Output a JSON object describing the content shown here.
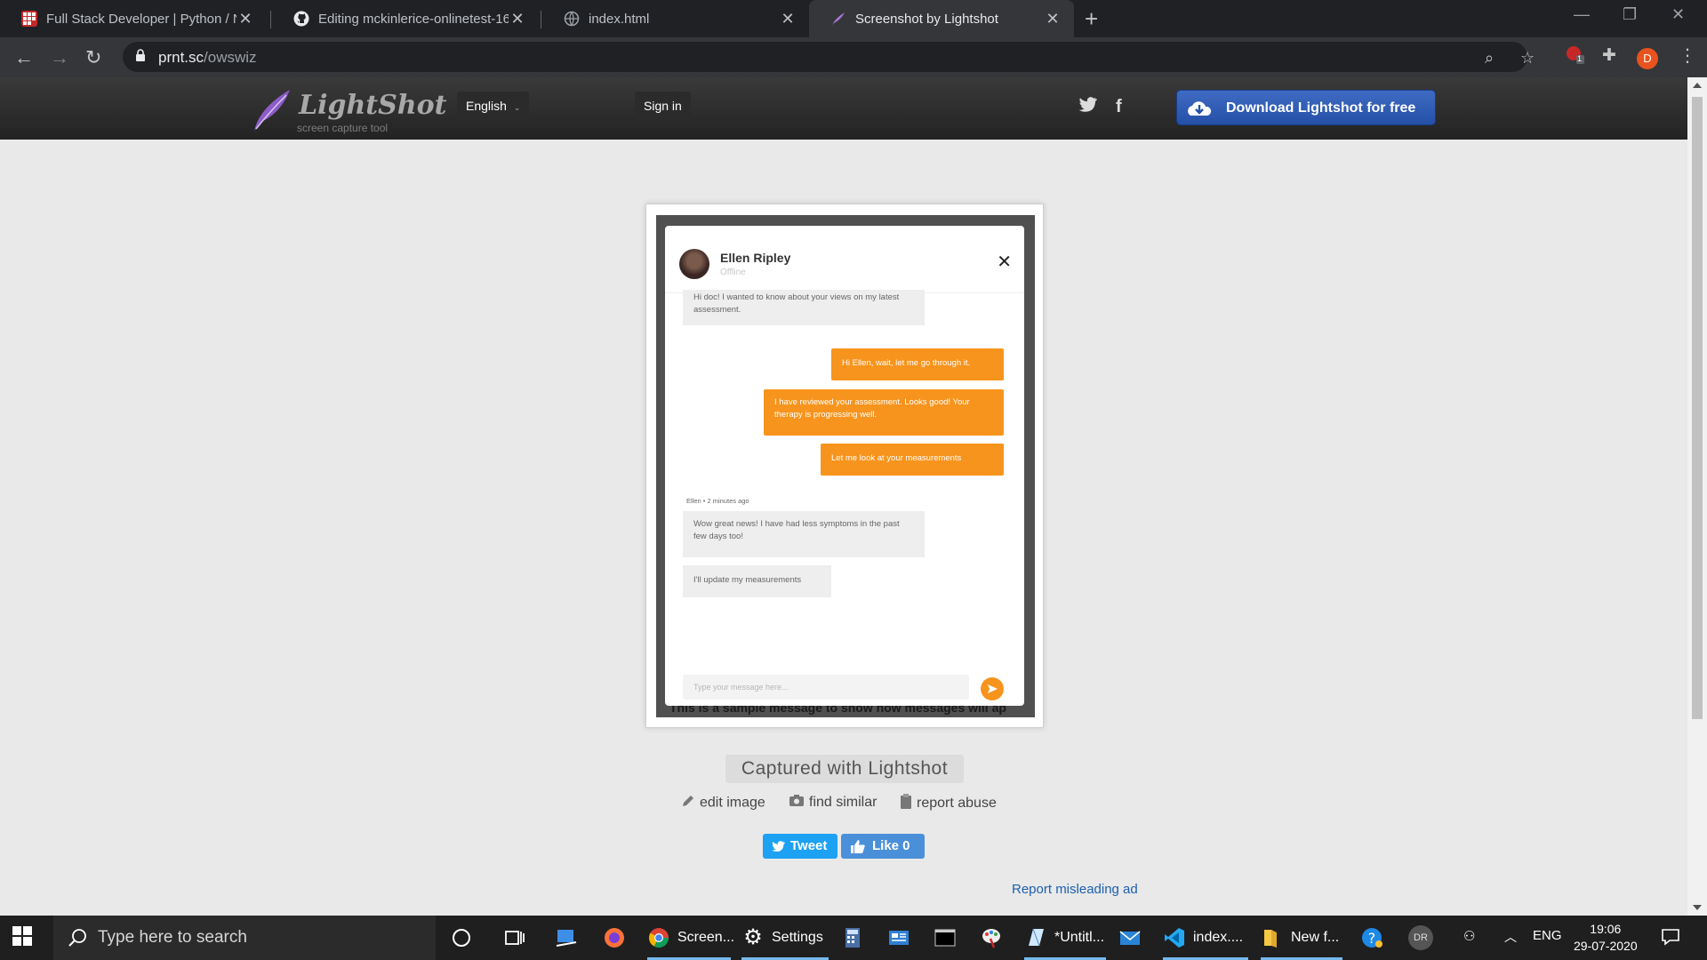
{
  "browser": {
    "tabs": [
      {
        "title": "Full Stack Developer | Python / N",
        "active": false
      },
      {
        "title": "Editing mckinlerice-onlinetest-16",
        "active": false
      },
      {
        "title": "index.html",
        "active": false
      },
      {
        "title": "Screenshot by Lightshot",
        "active": true
      }
    ],
    "url_host": "prnt.sc",
    "url_path": "/owswiz",
    "extension_badge": "1",
    "profile_initial": "D"
  },
  "lightshot": {
    "logo_name": "LightShot",
    "logo_sub": "screen capture tool",
    "language": "English",
    "signin": "Sign in",
    "download_label": "Download Lightshot for free",
    "captured_label": "Captured with Lightshot",
    "actions": {
      "edit": "edit image",
      "similar": "find similar",
      "report": "report abuse"
    },
    "tweet": "Tweet",
    "like": "Like 0",
    "report_ad": "Report misleading ad"
  },
  "screenshot": {
    "contact_name": "Ellen Ripley",
    "contact_status": "Offline",
    "messages": [
      {
        "dir": "in",
        "text": "Hi doc! I wanted to know about your views on my latest assessment."
      },
      {
        "dir": "out",
        "text": "Hi Ellen, wait, let me go through it."
      },
      {
        "dir": "out",
        "text": "I have reviewed your assessment. Looks good! Your therapy is progressing well."
      },
      {
        "dir": "out",
        "text": "Let me look at your measurements"
      },
      {
        "dir": "in",
        "text": "Wow great news! I have had less symptoms in the past few days too!"
      },
      {
        "dir": "in",
        "text": "I'll update my measurements"
      }
    ],
    "meta": "Ellen • 2 minutes ago",
    "input_placeholder": "Type your message here...",
    "background_text": "This is a sample message to show how messages will ap"
  },
  "taskbar": {
    "search_placeholder": "Type here to search",
    "apps": [
      {
        "name": "Screen...",
        "open": true
      },
      {
        "name": "Settings",
        "open": true
      },
      {
        "name": "*Untitl...",
        "open": true
      },
      {
        "name": "index....",
        "open": true
      },
      {
        "name": "New f...",
        "open": true
      }
    ],
    "user_initials": "DR",
    "language": "ENG",
    "time": "19:06",
    "date": "29-07-2020"
  },
  "colors": {
    "accent_orange": "#f7941d",
    "download_blue": "#2450a8",
    "tweet_blue": "#1da1f2",
    "like_blue": "#4a90d9",
    "link_blue": "#1b5fb0"
  }
}
